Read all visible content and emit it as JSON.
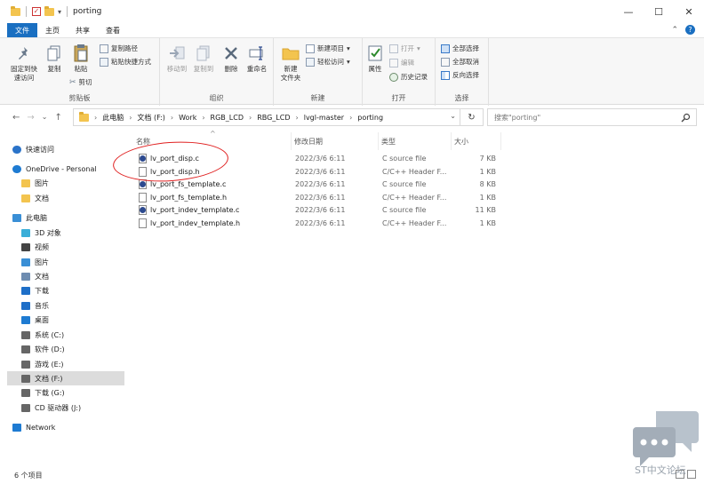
{
  "window": {
    "title": "porting",
    "quick_access_arrow": "▾",
    "minimize": "—",
    "maximize": "☐",
    "close": "✕"
  },
  "tabs": [
    {
      "label": "文件"
    },
    {
      "label": "主页"
    },
    {
      "label": "共享"
    },
    {
      "label": "查看"
    }
  ],
  "tab_right": {
    "collapse": "⌃",
    "help": "?"
  },
  "ribbon": {
    "clipboard": {
      "label": "剪贴板",
      "pin": "固定到快\n速访问",
      "copy": "复制",
      "paste": "粘贴",
      "copy_path": "复制路径",
      "paste_shortcut": "粘贴快捷方式",
      "cut": "剪切"
    },
    "organize": {
      "label": "组织",
      "move_to": "移动到",
      "copy_to": "复制到",
      "delete": "删除",
      "rename": "重命名"
    },
    "new": {
      "label": "新建",
      "new_folder": "新建\n文件夹",
      "new_item": "新建项目",
      "easy_access": "轻松访问"
    },
    "open": {
      "label": "打开",
      "properties": "属性",
      "open": "打开",
      "edit": "编辑",
      "history": "历史记录"
    },
    "select": {
      "label": "选择",
      "select_all": "全部选择",
      "select_none": "全部取消",
      "invert": "反向选择"
    }
  },
  "address": {
    "crumbs": [
      "此电脑",
      "文档 (F:)",
      "Work",
      "RGB_LCD",
      "RBG_LCD",
      "lvgl-master",
      "porting"
    ],
    "dropdown": "⌄",
    "refresh": "↻"
  },
  "search": {
    "placeholder": "搜索\"porting\""
  },
  "nav_buttons": {
    "back": "←",
    "forward": "→",
    "recent": "⌄",
    "up": "↑"
  },
  "navpane": [
    {
      "label": "快速访问",
      "icon": "star-icon",
      "color": "#2a73c9"
    },
    {
      "label": "OneDrive - Personal",
      "icon": "cloud-icon",
      "color": "#1e7bd2"
    },
    {
      "label": "图片",
      "icon": "folder-icon",
      "color": "#f3c44f"
    },
    {
      "label": "文档",
      "icon": "folder-icon",
      "color": "#f3c44f"
    },
    {
      "label": "此电脑",
      "icon": "computer-icon",
      "color": "#3a8fd6"
    },
    {
      "label": "3D 对象",
      "icon": "cube-icon",
      "color": "#3aaed8"
    },
    {
      "label": "视频",
      "icon": "video-icon",
      "color": "#444444"
    },
    {
      "label": "图片",
      "icon": "picture-icon",
      "color": "#3a8fd6"
    },
    {
      "label": "文档",
      "icon": "document-icon",
      "color": "#6e8cb0"
    },
    {
      "label": "下载",
      "icon": "download-icon",
      "color": "#1e6fc8"
    },
    {
      "label": "音乐",
      "icon": "music-icon",
      "color": "#1e6fc8"
    },
    {
      "label": "桌面",
      "icon": "desktop-icon",
      "color": "#1e7bd2"
    },
    {
      "label": "系统 (C:)",
      "icon": "drive-icon",
      "color": "#666666"
    },
    {
      "label": "软件 (D:)",
      "icon": "drive-icon",
      "color": "#666666"
    },
    {
      "label": "游戏 (E:)",
      "icon": "drive-icon",
      "color": "#666666"
    },
    {
      "label": "文档 (F:)",
      "icon": "drive-icon",
      "color": "#666666"
    },
    {
      "label": "下载 (G:)",
      "icon": "drive-icon",
      "color": "#666666"
    },
    {
      "label": "CD 驱动器 (J:)",
      "icon": "cd-drive-icon",
      "color": "#666666"
    },
    {
      "label": "Network",
      "icon": "network-icon",
      "color": "#1e7bd2"
    }
  ],
  "columns": {
    "name": "名称",
    "modified": "修改日期",
    "type": "类型",
    "size": "大小",
    "sort_arrow": "^"
  },
  "files": [
    {
      "name": "lv_port_disp.c",
      "modified": "2022/3/6 6:11",
      "type": "C source file",
      "size": "7 KB",
      "kind": "c"
    },
    {
      "name": "lv_port_disp.h",
      "modified": "2022/3/6 6:11",
      "type": "C/C++ Header F...",
      "size": "1 KB",
      "kind": "h"
    },
    {
      "name": "lv_port_fs_template.c",
      "modified": "2022/3/6 6:11",
      "type": "C source file",
      "size": "8 KB",
      "kind": "c"
    },
    {
      "name": "lv_port_fs_template.h",
      "modified": "2022/3/6 6:11",
      "type": "C/C++ Header F...",
      "size": "1 KB",
      "kind": "h"
    },
    {
      "name": "lv_port_indev_template.c",
      "modified": "2022/3/6 6:11",
      "type": "C source file",
      "size": "11 KB",
      "kind": "c"
    },
    {
      "name": "lv_port_indev_template.h",
      "modified": "2022/3/6 6:11",
      "type": "C/C++ Header F...",
      "size": "1 KB",
      "kind": "h"
    }
  ],
  "status": {
    "count": "6 个项目"
  },
  "watermark": {
    "text": "ST中文论坛"
  },
  "colors": {
    "accent": "#1a6fc1",
    "highlight_circle": "#e02020"
  }
}
